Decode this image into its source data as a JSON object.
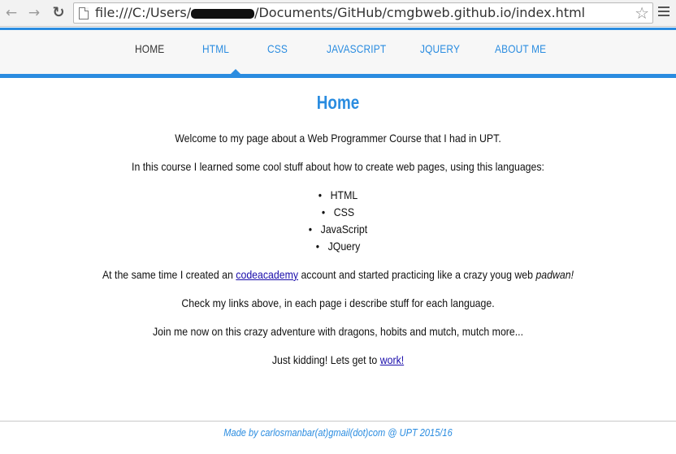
{
  "browser": {
    "url_prefix": "file:///C:/Users/",
    "url_suffix": "/Documents/GitHub/cmgbweb.github.io/index.html",
    "back_icon": "back-arrow",
    "forward_icon": "forward-arrow",
    "reload_icon": "reload",
    "bookmark_icon": "star",
    "menu_icon": "hamburger"
  },
  "nav": {
    "items": [
      {
        "label": "HOME"
      },
      {
        "label": "HTML"
      },
      {
        "label": "CSS"
      },
      {
        "label": "JAVASCRIPT"
      },
      {
        "label": "JQUERY"
      },
      {
        "label": "ABOUT ME"
      }
    ],
    "accent_color": "#2a8ce0"
  },
  "main": {
    "title": "Home",
    "welcome": "Welcome to my page about a Web Programmer Course that I had in UPT.",
    "intro": "In this course I learned some cool stuff about how to create web pages, using this languages:",
    "languages": [
      "HTML",
      "CSS",
      "JavaScript",
      "JQuery"
    ],
    "codeacademy_before": "At the same time I created an ",
    "codeacademy_link": "codeacademy",
    "codeacademy_middle": " account and started practicing like a crazy youg web ",
    "codeacademy_italic": "padwan!",
    "links_text": "Check my links above, in each page i describe stuff for each language.",
    "join_text": "Join me now on this crazy adventure with dragons, hobits and mutch, mutch more...",
    "kidding_before": "Just kidding! Lets get to ",
    "kidding_link": "work!"
  },
  "footer": {
    "text": "Made by carlosmanbar(at)gmail(dot)com @ UPT 2015/16"
  }
}
